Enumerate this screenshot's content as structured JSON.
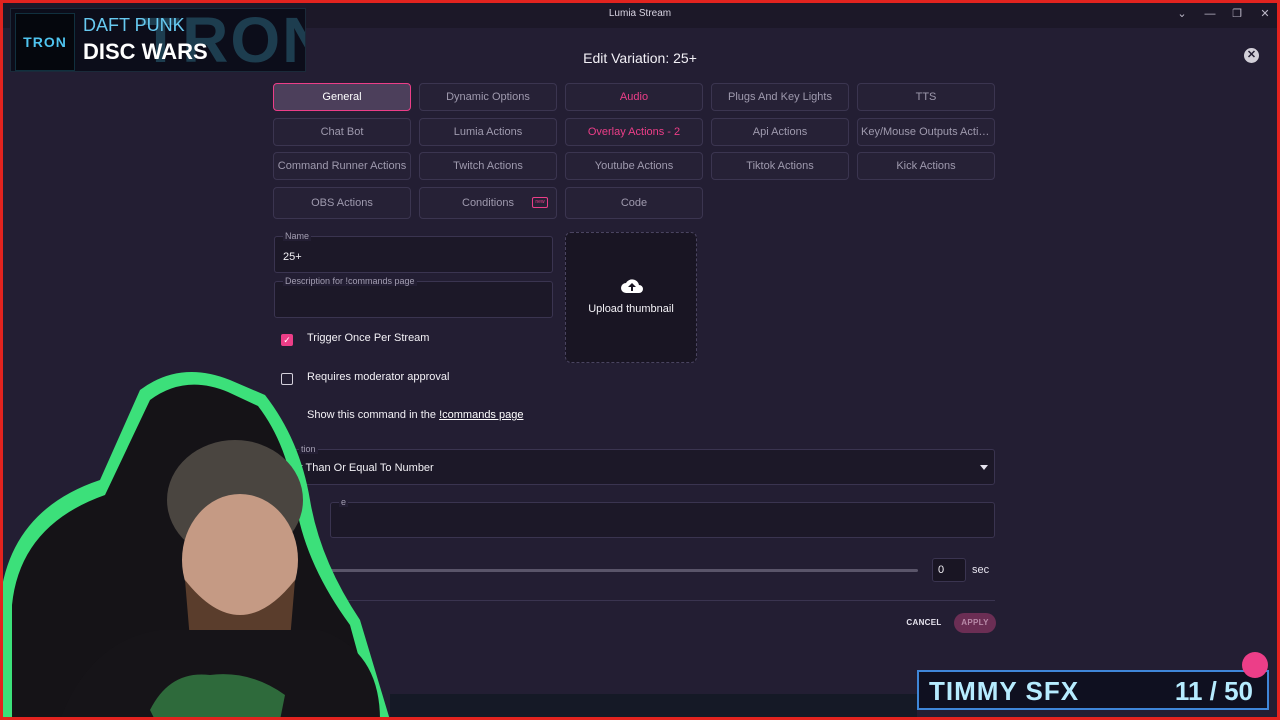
{
  "window": {
    "title": "Lumia Stream",
    "controls": [
      "minimize-icon",
      "restore-icon",
      "close-icon"
    ]
  },
  "now_playing": {
    "art_label": "TRON",
    "background_text": "TRON",
    "artist": "DAFT PUNK",
    "track": "DISC WARS"
  },
  "dialog": {
    "title": "Edit Variation: 25+"
  },
  "tabs": [
    {
      "label": "General",
      "state": "active"
    },
    {
      "label": "Dynamic Options",
      "state": "normal"
    },
    {
      "label": "Audio",
      "state": "highlight"
    },
    {
      "label": "Plugs And Key Lights",
      "state": "normal"
    },
    {
      "label": "TTS",
      "state": "normal"
    },
    {
      "label": "Chat Bot",
      "state": "normal"
    },
    {
      "label": "Lumia Actions",
      "state": "normal"
    },
    {
      "label": "Overlay Actions - 2",
      "state": "highlight"
    },
    {
      "label": "Api Actions",
      "state": "normal"
    },
    {
      "label": "Key/Mouse Outputs Actions",
      "state": "normal"
    },
    {
      "label": "Command Runner Actions",
      "state": "normal"
    },
    {
      "label": "Twitch Actions",
      "state": "normal"
    },
    {
      "label": "Youtube Actions",
      "state": "normal"
    },
    {
      "label": "Tiktok Actions",
      "state": "normal"
    },
    {
      "label": "Kick Actions",
      "state": "normal"
    },
    {
      "label": "OBS Actions",
      "state": "normal"
    },
    {
      "label": "Conditions",
      "state": "normal",
      "badge": "new"
    },
    {
      "label": "Code",
      "state": "normal"
    }
  ],
  "form": {
    "name_label": "Name",
    "name_value": "25+",
    "description_label": "Description for !commands page",
    "description_value": "",
    "upload_label": "Upload thumbnail",
    "trigger_once_label": "Trigger Once Per Stream",
    "trigger_once_checked": true,
    "moderator_label": "Requires moderator approval",
    "moderator_checked": false,
    "show_command_prefix": "Show this command in the ",
    "show_command_link": "!commands page",
    "condition_label": "tion",
    "condition_value": "r Than Or Equal To Number",
    "value_label": "e",
    "value_value": "",
    "delay_value": "0",
    "delay_unit": "sec"
  },
  "actions": {
    "cancel": "CANCEL",
    "apply": "APPLY"
  },
  "sfx_counter": {
    "name": "TIMMY SFX",
    "count": "11 / 50"
  },
  "colors": {
    "accent": "#ec3e88",
    "background": "#231e33",
    "frame": "#e2231f",
    "cam_glow": "#3ce07a"
  }
}
